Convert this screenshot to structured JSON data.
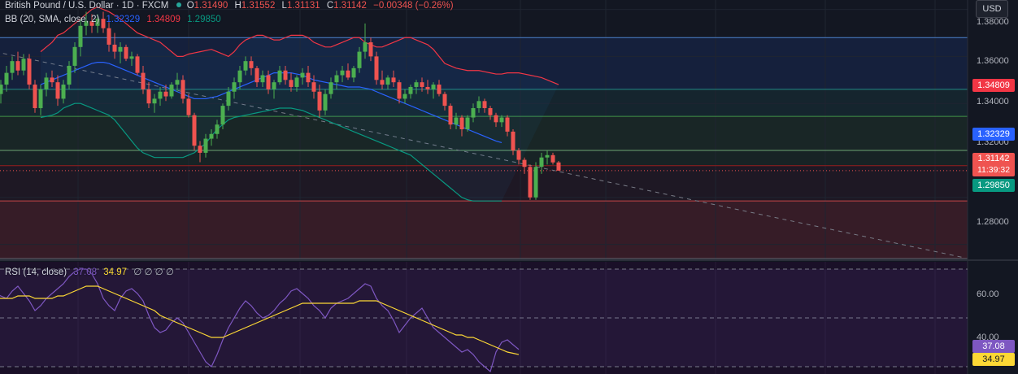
{
  "legend": {
    "symbol": "British Pound / U.S. Dollar · 1D · FXCM",
    "o_label": "O",
    "o": "1.31490",
    "h_label": "H",
    "h": "1.31552",
    "l_label": "L",
    "l": "1.31131",
    "c_label": "C",
    "c": "1.31142",
    "change": "−0.00348 (−0.26%)",
    "bb_label": "BB (20, SMA, close, 2)",
    "bb_basis": "1.32329",
    "bb_upper": "1.34809",
    "bb_lower": "1.29850",
    "rsi_label": "RSI (14, close)",
    "rsi_value": "37.08",
    "rsi_ma": "34.97",
    "rsi_extra": "∅ ∅ ∅ ∅"
  },
  "currency_button": "USD",
  "price_axis": {
    "ticks": [
      "1.38000",
      "1.36000",
      "1.34000",
      "1.32000",
      "1.28000"
    ]
  },
  "price_tags": {
    "upper": "1.34809",
    "basis": "1.32329",
    "last": "1.31142",
    "countdown": "11:39:32",
    "lower": "1.29850"
  },
  "rsi_axis": {
    "ticks": [
      "60.00",
      "40.00"
    ]
  },
  "rsi_tags": {
    "rsi": "37.08",
    "ma": "34.97"
  },
  "colors": {
    "background": "#131722",
    "up": "#26a69a",
    "up_candle": "#4caf50",
    "down": "#ef5350",
    "bb_upper": "#f23645",
    "bb_basis": "#2962ff",
    "bb_lower": "#089981",
    "rsi": "#7e57c2",
    "rsi_ma": "#fdd835"
  },
  "chart_data": [
    {
      "type": "candlestick",
      "title": "British Pound / U.S. Dollar · 1D · FXCM",
      "ylim": [
        1.274,
        1.384
      ],
      "candles": [
        [
          1.347,
          1.352,
          1.342,
          1.344
        ],
        [
          1.344,
          1.35,
          1.34,
          1.348
        ],
        [
          1.348,
          1.356,
          1.345,
          1.353
        ],
        [
          1.353,
          1.36,
          1.35,
          1.358
        ],
        [
          1.358,
          1.362,
          1.352,
          1.354
        ],
        [
          1.354,
          1.361,
          1.352,
          1.359
        ],
        [
          1.359,
          1.361,
          1.346,
          1.348
        ],
        [
          1.348,
          1.35,
          1.336,
          1.338
        ],
        [
          1.338,
          1.348,
          1.335,
          1.346
        ],
        [
          1.346,
          1.353,
          1.343,
          1.351
        ],
        [
          1.351,
          1.354,
          1.347,
          1.349
        ],
        [
          1.349,
          1.352,
          1.339,
          1.342
        ],
        [
          1.342,
          1.35,
          1.34,
          1.348
        ],
        [
          1.348,
          1.358,
          1.346,
          1.356
        ],
        [
          1.356,
          1.366,
          1.353,
          1.364
        ],
        [
          1.364,
          1.376,
          1.36,
          1.373
        ],
        [
          1.373,
          1.379,
          1.369,
          1.375
        ],
        [
          1.375,
          1.378,
          1.37,
          1.373
        ],
        [
          1.373,
          1.378,
          1.37,
          1.376
        ],
        [
          1.376,
          1.379,
          1.37,
          1.372
        ],
        [
          1.372,
          1.375,
          1.362,
          1.365
        ],
        [
          1.365,
          1.37,
          1.359,
          1.362
        ],
        [
          1.362,
          1.366,
          1.357,
          1.364
        ],
        [
          1.364,
          1.365,
          1.358,
          1.359
        ],
        [
          1.359,
          1.362,
          1.356,
          1.36
        ],
        [
          1.36,
          1.361,
          1.352,
          1.353
        ],
        [
          1.353,
          1.356,
          1.344,
          1.346
        ],
        [
          1.346,
          1.349,
          1.338,
          1.34
        ],
        [
          1.34,
          1.344,
          1.336,
          1.342
        ],
        [
          1.342,
          1.347,
          1.339,
          1.345
        ],
        [
          1.345,
          1.348,
          1.341,
          1.343
        ],
        [
          1.343,
          1.349,
          1.342,
          1.348
        ],
        [
          1.348,
          1.353,
          1.345,
          1.35
        ],
        [
          1.35,
          1.352,
          1.34,
          1.342
        ],
        [
          1.342,
          1.344,
          1.334,
          1.335
        ],
        [
          1.335,
          1.336,
          1.32,
          1.322
        ],
        [
          1.322,
          1.324,
          1.315,
          1.319
        ],
        [
          1.319,
          1.327,
          1.317,
          1.325
        ],
        [
          1.325,
          1.329,
          1.322,
          1.327
        ],
        [
          1.327,
          1.333,
          1.325,
          1.331
        ],
        [
          1.331,
          1.34,
          1.329,
          1.339
        ],
        [
          1.339,
          1.347,
          1.337,
          1.345
        ],
        [
          1.345,
          1.351,
          1.342,
          1.349
        ],
        [
          1.349,
          1.356,
          1.346,
          1.354
        ],
        [
          1.354,
          1.36,
          1.352,
          1.358
        ],
        [
          1.358,
          1.36,
          1.352,
          1.355
        ],
        [
          1.355,
          1.356,
          1.347,
          1.349
        ],
        [
          1.349,
          1.354,
          1.347,
          1.352
        ],
        [
          1.352,
          1.354,
          1.344,
          1.346
        ],
        [
          1.346,
          1.35,
          1.342,
          1.349
        ],
        [
          1.349,
          1.356,
          1.348,
          1.354
        ],
        [
          1.354,
          1.356,
          1.348,
          1.35
        ],
        [
          1.35,
          1.353,
          1.345,
          1.347
        ],
        [
          1.347,
          1.352,
          1.345,
          1.351
        ],
        [
          1.351,
          1.355,
          1.348,
          1.353
        ],
        [
          1.353,
          1.356,
          1.347,
          1.349
        ],
        [
          1.349,
          1.352,
          1.342,
          1.345
        ],
        [
          1.345,
          1.348,
          1.334,
          1.337
        ],
        [
          1.337,
          1.346,
          1.335,
          1.344
        ],
        [
          1.344,
          1.351,
          1.342,
          1.349
        ],
        [
          1.349,
          1.354,
          1.346,
          1.352
        ],
        [
          1.352,
          1.356,
          1.349,
          1.354
        ],
        [
          1.354,
          1.357,
          1.35,
          1.351
        ],
        [
          1.351,
          1.356,
          1.349,
          1.355
        ],
        [
          1.355,
          1.364,
          1.353,
          1.362
        ],
        [
          1.362,
          1.374,
          1.359,
          1.366
        ],
        [
          1.366,
          1.368,
          1.358,
          1.36
        ],
        [
          1.36,
          1.362,
          1.348,
          1.35
        ],
        [
          1.35,
          1.354,
          1.346,
          1.348
        ],
        [
          1.348,
          1.352,
          1.346,
          1.351
        ],
        [
          1.351,
          1.354,
          1.347,
          1.349
        ],
        [
          1.349,
          1.35,
          1.34,
          1.342
        ],
        [
          1.342,
          1.346,
          1.34,
          1.344
        ],
        [
          1.344,
          1.348,
          1.342,
          1.347
        ],
        [
          1.347,
          1.35,
          1.344,
          1.349
        ],
        [
          1.349,
          1.351,
          1.345,
          1.347
        ],
        [
          1.347,
          1.35,
          1.344,
          1.346
        ],
        [
          1.346,
          1.349,
          1.342,
          1.348
        ],
        [
          1.348,
          1.35,
          1.343,
          1.344
        ],
        [
          1.344,
          1.345,
          1.337,
          1.339
        ],
        [
          1.339,
          1.34,
          1.329,
          1.331
        ],
        [
          1.331,
          1.336,
          1.329,
          1.334
        ],
        [
          1.334,
          1.335,
          1.326,
          1.329
        ],
        [
          1.329,
          1.335,
          1.328,
          1.334
        ],
        [
          1.334,
          1.34,
          1.332,
          1.338
        ],
        [
          1.338,
          1.343,
          1.336,
          1.341
        ],
        [
          1.341,
          1.342,
          1.336,
          1.338
        ],
        [
          1.338,
          1.339,
          1.333,
          1.335
        ],
        [
          1.335,
          1.336,
          1.33,
          1.332
        ],
        [
          1.332,
          1.335,
          1.33,
          1.334
        ],
        [
          1.334,
          1.335,
          1.326,
          1.328
        ],
        [
          1.328,
          1.329,
          1.318,
          1.32
        ],
        [
          1.32,
          1.321,
          1.314,
          1.316
        ],
        [
          1.316,
          1.317,
          1.31,
          1.313
        ],
        [
          1.313,
          1.314,
          1.299,
          1.3
        ],
        [
          1.3,
          1.315,
          1.299,
          1.313
        ],
        [
          1.313,
          1.319,
          1.31,
          1.317
        ],
        [
          1.317,
          1.32,
          1.314,
          1.318
        ],
        [
          1.318,
          1.319,
          1.314,
          1.3149
        ],
        [
          1.3149,
          1.31552,
          1.31131,
          1.31142
        ]
      ],
      "bb_upper": [
        1.362,
        1.364,
        1.366,
        1.369,
        1.37,
        1.372,
        1.374,
        1.376,
        1.378,
        1.38,
        1.381,
        1.38,
        1.379,
        1.3775,
        1.376,
        1.374,
        1.372,
        1.37,
        1.369,
        1.368,
        1.367,
        1.366,
        1.364,
        1.362,
        1.36,
        1.36,
        1.361,
        1.3615,
        1.362,
        1.3625,
        1.363,
        1.362,
        1.361,
        1.36,
        1.362,
        1.365,
        1.367,
        1.368,
        1.369,
        1.369,
        1.368,
        1.367,
        1.367,
        1.368,
        1.369,
        1.369,
        1.369,
        1.368,
        1.366,
        1.365,
        1.364,
        1.364,
        1.365,
        1.366,
        1.367,
        1.368,
        1.368,
        1.366,
        1.365,
        1.364,
        1.364,
        1.365,
        1.366,
        1.367,
        1.368,
        1.368,
        1.367,
        1.366,
        1.365,
        1.363,
        1.36,
        1.357,
        1.356,
        1.355,
        1.3545,
        1.354,
        1.354,
        1.354,
        1.3535,
        1.353,
        1.3525,
        1.3525,
        1.353,
        1.353,
        1.353,
        1.3525,
        1.352,
        1.3515,
        1.351,
        1.35,
        1.349,
        1.348
      ],
      "bb_basis": [
        1.348,
        1.349,
        1.35,
        1.351,
        1.352,
        1.353,
        1.354,
        1.355,
        1.356,
        1.357,
        1.3575,
        1.3575,
        1.357,
        1.356,
        1.355,
        1.354,
        1.353,
        1.352,
        1.351,
        1.35,
        1.349,
        1.348,
        1.347,
        1.346,
        1.345,
        1.344,
        1.343,
        1.342,
        1.342,
        1.342,
        1.3425,
        1.343,
        1.344,
        1.345,
        1.346,
        1.347,
        1.348,
        1.349,
        1.35,
        1.351,
        1.352,
        1.353,
        1.353,
        1.353,
        1.353,
        1.3525,
        1.352,
        1.351,
        1.35,
        1.3495,
        1.349,
        1.3485,
        1.348,
        1.3475,
        1.347,
        1.347,
        1.347,
        1.3465,
        1.346,
        1.345,
        1.344,
        1.343,
        1.342,
        1.341,
        1.34,
        1.339,
        1.338,
        1.337,
        1.336,
        1.335,
        1.334,
        1.333,
        1.332,
        1.331,
        1.33,
        1.329,
        1.328,
        1.327,
        1.326,
        1.325,
        1.324,
        1.3233
      ],
      "bb_lower": [
        1.334,
        1.3345,
        1.335,
        1.336,
        1.338,
        1.339,
        1.34,
        1.34,
        1.339,
        1.338,
        1.337,
        1.336,
        1.335,
        1.333,
        1.33,
        1.327,
        1.324,
        1.321,
        1.319,
        1.318,
        1.317,
        1.317,
        1.317,
        1.317,
        1.317,
        1.317,
        1.318,
        1.319,
        1.321,
        1.323,
        1.326,
        1.329,
        1.331,
        1.333,
        1.334,
        1.3345,
        1.335,
        1.3355,
        1.336,
        1.3365,
        1.337,
        1.3375,
        1.338,
        1.338,
        1.338,
        1.3375,
        1.337,
        1.336,
        1.335,
        1.334,
        1.333,
        1.332,
        1.331,
        1.33,
        1.329,
        1.328,
        1.327,
        1.326,
        1.325,
        1.324,
        1.323,
        1.322,
        1.321,
        1.32,
        1.319,
        1.318,
        1.316,
        1.314,
        1.312,
        1.31,
        1.308,
        1.306,
        1.304,
        1.302,
        1.3,
        1.299,
        1.2985,
        1.2985,
        1.2985,
        1.2985,
        1.2985,
        1.2985
      ],
      "horizontal_levels": [
        1.368,
        1.346,
        1.3345,
        1.32,
        1.3135,
        1.2985,
        1.274
      ],
      "trendline": [
        [
          0,
          1.362
        ],
        [
          170,
          1.2745
        ]
      ]
    },
    {
      "type": "line",
      "title": "RSI (14, close)",
      "ylim": [
        27,
        73
      ],
      "levels": [
        70,
        50,
        30
      ],
      "series": [
        {
          "values": [
            60,
            59,
            58,
            61,
            63,
            60,
            57,
            53,
            55,
            58,
            60,
            62,
            64,
            67,
            69,
            70,
            70,
            68,
            64,
            58,
            55,
            53,
            58,
            61,
            62,
            60,
            57,
            51,
            46,
            44,
            45,
            48,
            50,
            48,
            44,
            40,
            36,
            32,
            30,
            35,
            41,
            46,
            50,
            54,
            57,
            55,
            52,
            50,
            51,
            53,
            56,
            58,
            61,
            62,
            60,
            58,
            55,
            53,
            50,
            54,
            56,
            57,
            58,
            60,
            62,
            64,
            63,
            58,
            55,
            53,
            49,
            44,
            47,
            50,
            52,
            54,
            50,
            46,
            44,
            42,
            40,
            38,
            36,
            37,
            35,
            32,
            30,
            28,
            36,
            40,
            41,
            39,
            37.08
          ]
        },
        {
          "values": [
            58,
            58,
            58,
            58,
            59,
            59,
            59,
            58,
            58,
            58,
            58,
            59,
            59,
            60,
            61,
            62,
            63,
            63,
            63,
            62,
            61,
            60,
            59,
            58,
            57,
            56,
            55,
            54,
            53,
            51,
            50,
            49,
            48,
            47,
            46,
            45,
            44,
            43,
            42,
            42,
            42,
            43,
            44,
            45,
            46,
            47,
            48,
            49,
            50,
            51,
            52,
            53,
            54,
            55,
            56,
            56,
            56,
            56,
            56,
            56,
            56,
            56,
            56,
            56,
            57,
            57,
            57,
            57,
            56,
            55,
            54,
            53,
            52,
            51,
            50,
            49,
            48,
            47,
            46,
            45,
            44,
            43,
            43,
            42,
            42,
            41,
            40,
            39,
            38,
            37,
            36,
            35.5,
            34.97
          ]
        }
      ]
    }
  ]
}
